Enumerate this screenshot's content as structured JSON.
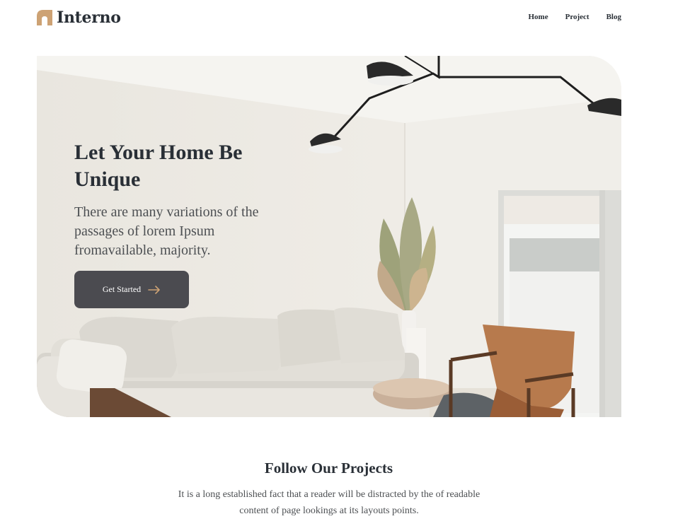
{
  "brand": {
    "name": "Interno",
    "accent": "#CDA274"
  },
  "nav": {
    "items": [
      "Home",
      "Project",
      "Blog"
    ]
  },
  "hero": {
    "title": "Let Your Home Be Unique",
    "subtitle": "There are many variations of the passages of lorem Ipsum fromavailable, majority.",
    "button_label": "Get Started",
    "button_color": "#4b4b50"
  },
  "projects": {
    "title": "Follow Our Projects",
    "text": "It is a long established fact that a reader will be distracted by the of readable content of page lookings at its layouts points."
  }
}
